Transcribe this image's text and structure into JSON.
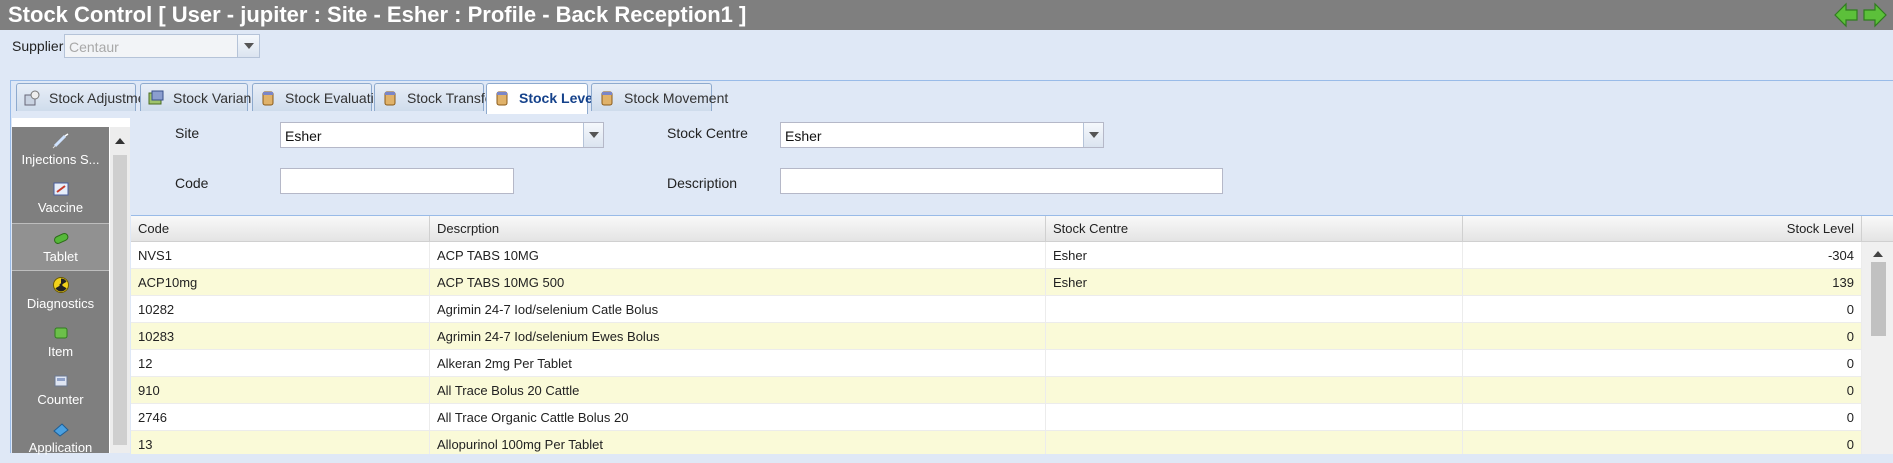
{
  "window": {
    "title": "Stock Control [ User - jupiter : Site - Esher : Profile - Back Reception1 ]",
    "nav_back_icon": "green-left-arrow-icon",
    "nav_forward_icon": "green-right-arrow-icon"
  },
  "supplier": {
    "label": "Supplier",
    "value": "Centaur"
  },
  "tabs": [
    {
      "label": "Stock Adjustment",
      "icon": "adjustment-icon"
    },
    {
      "label": "Stock Variance",
      "icon": "variance-icon"
    },
    {
      "label": "Stock Evaluation",
      "icon": "jar-icon"
    },
    {
      "label": "Stock Transfer",
      "icon": "jar-icon"
    },
    {
      "label": "Stock Level",
      "icon": "jar-icon",
      "active": true
    },
    {
      "label": "Stock Movement",
      "icon": "jar-icon"
    }
  ],
  "sidebar": {
    "items": [
      {
        "label": "Injections S...",
        "icon": "syringe-icon"
      },
      {
        "label": "Vaccine",
        "icon": "vaccine-icon"
      },
      {
        "label": "Tablet",
        "icon": "pill-icon",
        "active": true
      },
      {
        "label": "Diagnostics",
        "icon": "radiation-icon"
      },
      {
        "label": "Item",
        "icon": "item-icon"
      },
      {
        "label": "Counter",
        "icon": "counter-icon"
      },
      {
        "label": "Application",
        "icon": "application-icon"
      }
    ]
  },
  "filters": {
    "site_label": "Site",
    "site_value": "Esher",
    "stock_centre_label": "Stock Centre",
    "stock_centre_value": "Esher",
    "code_label": "Code",
    "code_value": "",
    "description_label": "Description",
    "description_value": ""
  },
  "grid": {
    "columns": [
      "Code",
      "Descrption",
      "Stock Centre",
      "Stock Level"
    ],
    "rows": [
      {
        "code": "NVS1",
        "description": "ACP TABS 10MG",
        "centre": "Esher",
        "level": "-304"
      },
      {
        "code": "ACP10mg",
        "description": "ACP TABS 10MG 500",
        "centre": "Esher",
        "level": "139"
      },
      {
        "code": "10282",
        "description": "Agrimin 24-7 Iod/selenium Catle Bolus",
        "centre": "",
        "level": "0"
      },
      {
        "code": "10283",
        "description": "Agrimin 24-7 Iod/selenium Ewes Bolus",
        "centre": "",
        "level": "0"
      },
      {
        "code": "12",
        "description": "Alkeran 2mg Per Tablet",
        "centre": "",
        "level": "0"
      },
      {
        "code": "910",
        "description": "All Trace Bolus 20 Cattle",
        "centre": "",
        "level": "0"
      },
      {
        "code": "2746",
        "description": "All Trace Organic Cattle Bolus 20",
        "centre": "",
        "level": "0"
      },
      {
        "code": "13",
        "description": "Allopurinol 100mg Per Tablet",
        "centre": "",
        "level": "0"
      }
    ]
  },
  "colors": {
    "titlebar": "#7f7f7f",
    "panel_bg": "#dfe8f6",
    "row_alt": "#fafad8",
    "active_tab_text": "#15428b"
  }
}
